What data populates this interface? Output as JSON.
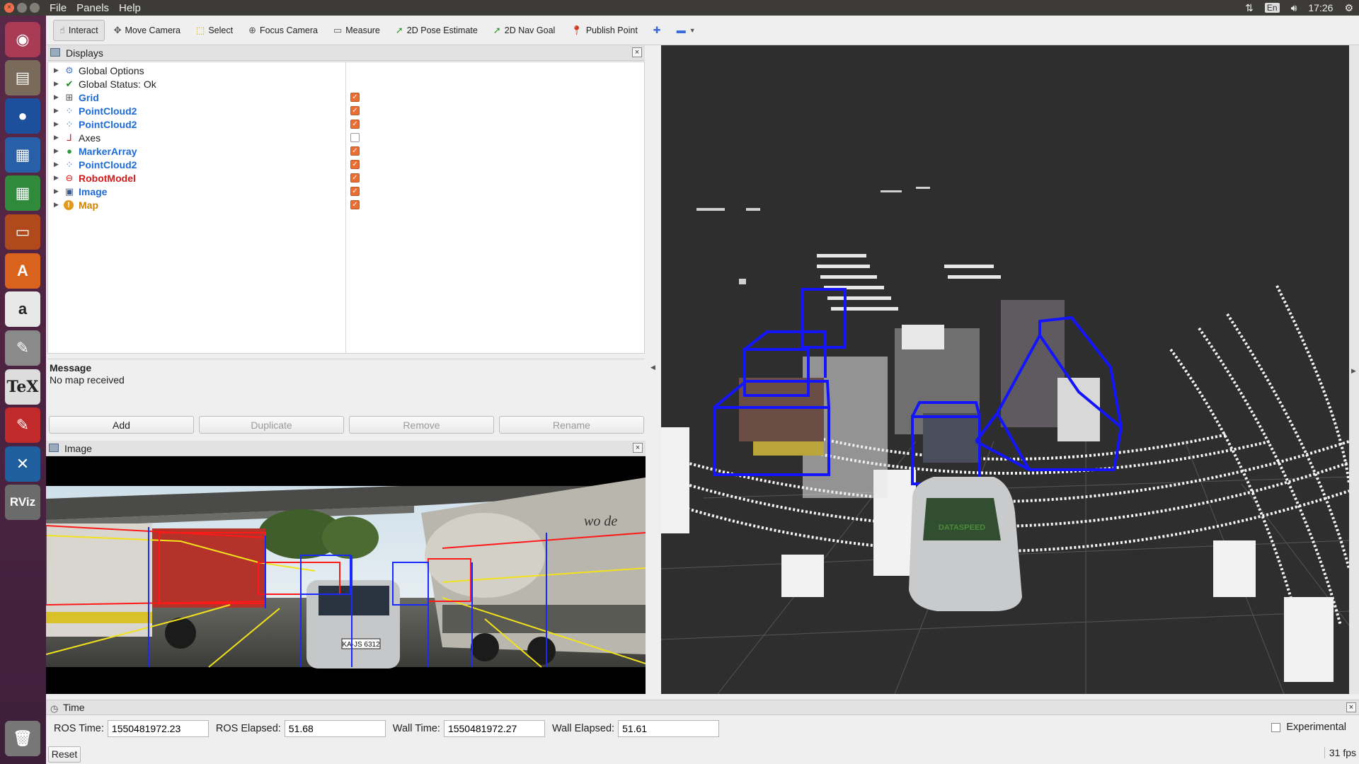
{
  "menu": [
    "File",
    "Panels",
    "Help"
  ],
  "tray": {
    "lang": "En",
    "time": "17:26"
  },
  "toolbar": {
    "tools": [
      "Interact",
      "Move Camera",
      "Select",
      "Focus Camera",
      "Measure",
      "2D Pose Estimate",
      "2D Nav Goal",
      "Publish Point"
    ]
  },
  "displays": {
    "title": "Displays",
    "rows": [
      {
        "label": "Global Options",
        "style": "normal",
        "icon": "gear-icon",
        "checkbox": null
      },
      {
        "label": "Global Status: Ok",
        "style": "normal",
        "icon": "check-icon",
        "checkbox": null
      },
      {
        "label": "Grid",
        "style": "blue",
        "icon": "grid-icon",
        "checkbox": true
      },
      {
        "label": "PointCloud2",
        "style": "blue",
        "icon": "pointcloud-icon",
        "checkbox": true
      },
      {
        "label": "PointCloud2",
        "style": "blue",
        "icon": "pointcloud-icon",
        "checkbox": true
      },
      {
        "label": "Axes",
        "style": "normal",
        "icon": "axes-icon",
        "checkbox": false
      },
      {
        "label": "MarkerArray",
        "style": "blue",
        "icon": "marker-icon",
        "checkbox": true
      },
      {
        "label": "PointCloud2",
        "style": "blue",
        "icon": "pointcloud-icon",
        "checkbox": true
      },
      {
        "label": "RobotModel",
        "style": "red",
        "icon": "robot-icon",
        "checkbox": true
      },
      {
        "label": "Image",
        "style": "blue",
        "icon": "image-icon",
        "checkbox": true
      },
      {
        "label": "Map",
        "style": "orange",
        "icon": "warning-icon",
        "checkbox": true
      }
    ],
    "message_header": "Message",
    "message_body": "No map received",
    "buttons": {
      "add": "Add",
      "duplicate": "Duplicate",
      "remove": "Remove",
      "rename": "Rename"
    }
  },
  "image_panel": {
    "title": "Image",
    "plate_text": "KA-JS 6312",
    "truck_text": "wo de"
  },
  "view3d": {
    "car_text": "DATASPEED"
  },
  "time": {
    "title": "Time",
    "ros_time_label": "ROS Time:",
    "ros_time": "1550481972.23",
    "ros_elapsed_label": "ROS Elapsed:",
    "ros_elapsed": "51.68",
    "wall_time_label": "Wall Time:",
    "wall_time": "1550481972.27",
    "wall_elapsed_label": "Wall Elapsed:",
    "wall_elapsed": "51.61",
    "experimental_label": "Experimental"
  },
  "status": {
    "reset_label": "Reset",
    "fps": "31 fps"
  }
}
